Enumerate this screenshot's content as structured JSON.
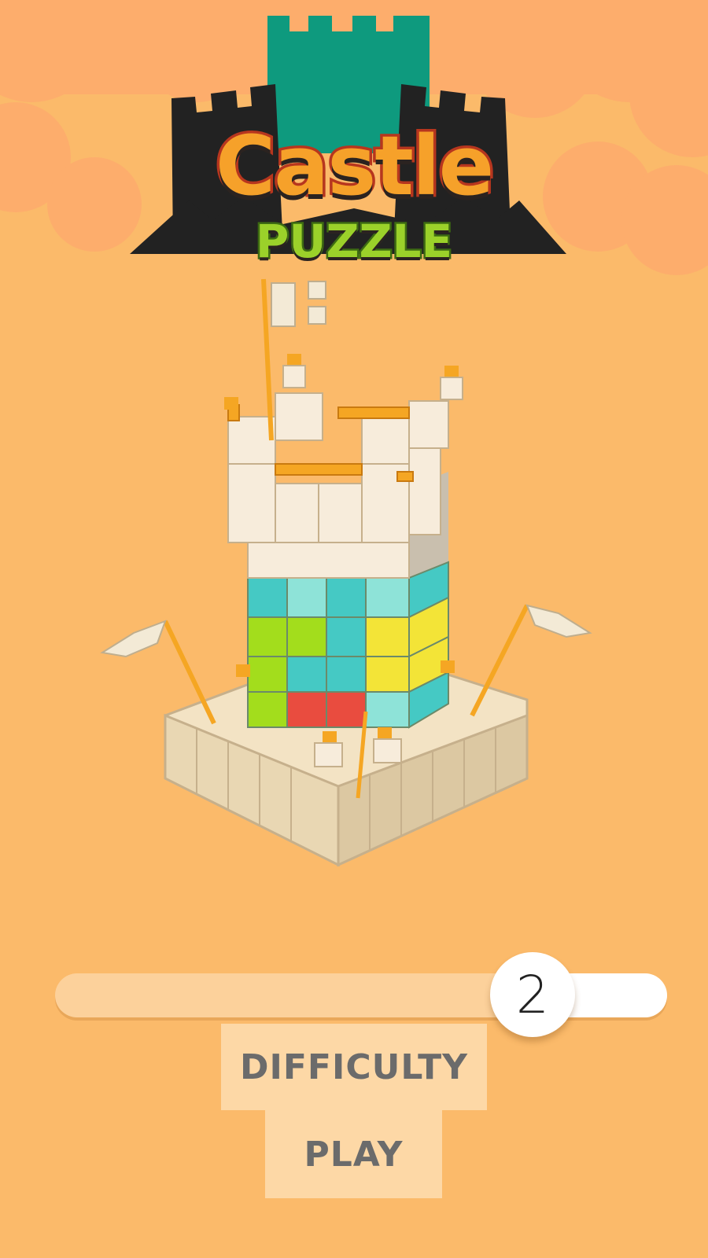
{
  "logo": {
    "title": "Castle",
    "subtitle": "PUZZLE"
  },
  "difficulty_slider": {
    "value": "2",
    "level_fraction": 0.78
  },
  "buttons": {
    "difficulty_label": "DIFFICULTY",
    "play_label": "PLAY"
  },
  "colors": {
    "background": "#fbba6a",
    "cloud": "#fdb070",
    "button_bg": "#fdd8a6",
    "logo_tower_green": "#0e9a7e",
    "logo_silhouette": "#222222",
    "block_teal": "#45c9c4",
    "block_lime": "#a3dd1c",
    "block_yellow": "#f3e437",
    "block_red": "#e94c3f"
  }
}
